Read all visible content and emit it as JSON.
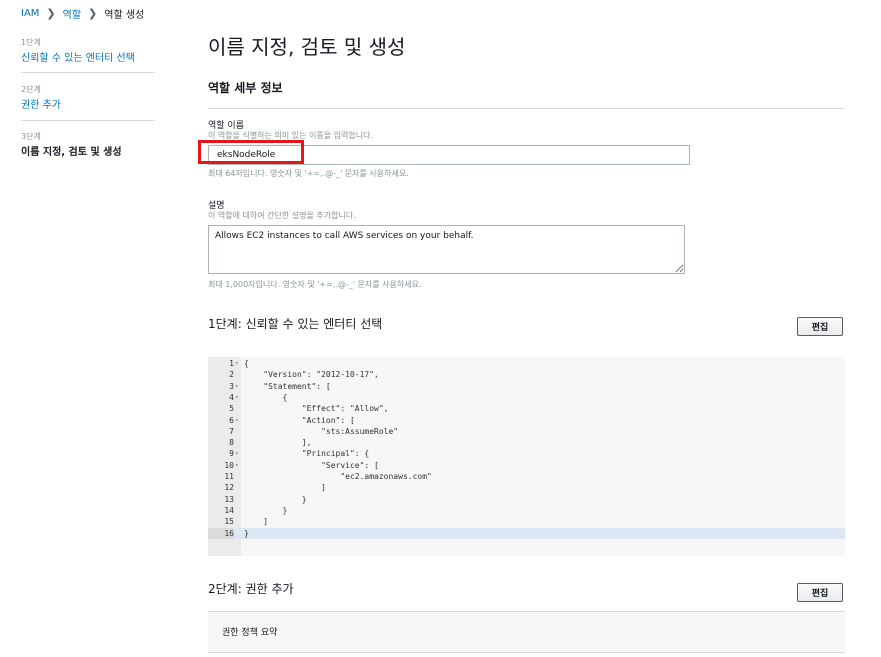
{
  "breadcrumb": {
    "items": [
      "IAM",
      "역할",
      "역할 생성"
    ]
  },
  "steps": [
    {
      "number": "1단계",
      "label": "신뢰할 수 있는 엔터티 선택"
    },
    {
      "number": "2단계",
      "label": "권한 추가"
    },
    {
      "number": "3단계",
      "label": "이름 지정, 검토 및 생성"
    }
  ],
  "page_title": "이름 지정, 검토 및 생성",
  "role_details": {
    "title": "역할 세부 정보",
    "name_label": "역할 이름",
    "name_hint": "이 역할을 식별하는 의미 있는 이름을 입력합니다.",
    "name_value": "eksNodeRole",
    "name_constraint": "최대 64자입니다. 영숫자 및 '+=,.@-_' 문자를 사용하세요.",
    "desc_label": "설명",
    "desc_hint": "이 역할에 대하여 간단한 설명을 추가합니다.",
    "desc_value": "Allows EC2 instances to call AWS services on your behalf.",
    "desc_constraint": "최대 1,000자입니다. 영숫자 및 '+=,.@-_' 문자를 사용하세요."
  },
  "step1": {
    "title": "1단계: 신뢰할 수 있는 엔터티 선택",
    "edit_label": "편집",
    "code_lines": [
      "{",
      "    \"Version\": \"2012-10-17\",",
      "    \"Statement\": [",
      "        {",
      "            \"Effect\": \"Allow\",",
      "            \"Action\": [",
      "                \"sts:AssumeRole\"",
      "            ],",
      "            \"Principal\": {",
      "                \"Service\": [",
      "                    \"ec2.amazonaws.com\"",
      "                ]",
      "            }",
      "        }",
      "    ]",
      "}"
    ]
  },
  "step2": {
    "title": "2단계: 권한 추가",
    "edit_label": "편집",
    "summary_label": "권한 정책 요약"
  },
  "colors": {
    "link": "#0073bb",
    "highlight": "#e4161b",
    "border": "#d5dbdb"
  }
}
